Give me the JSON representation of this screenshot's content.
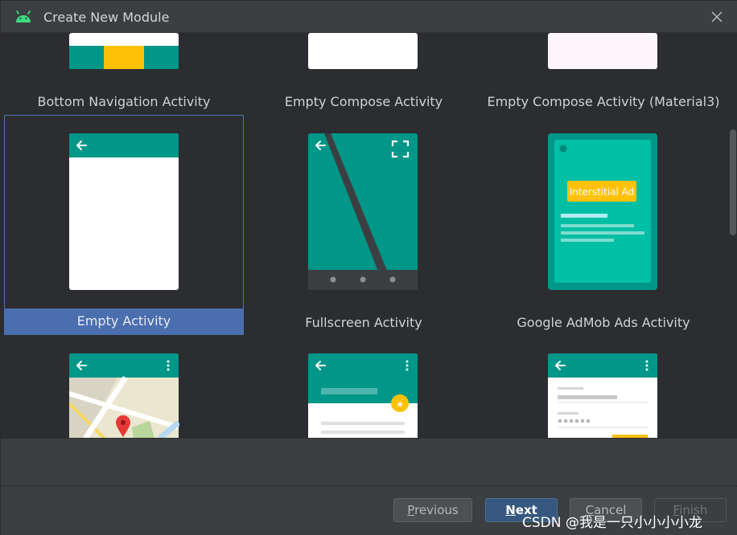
{
  "window": {
    "title": "Create New Module",
    "app_icon": "android-icon",
    "close_icon": "close-icon"
  },
  "templates": [
    {
      "label": "Bottom Navigation Activity",
      "icon": "bottom-navigation-preview",
      "selected": false
    },
    {
      "label": "Empty Compose Activity",
      "icon": "empty-compose-preview",
      "selected": false
    },
    {
      "label": "Empty Compose Activity (Material3)",
      "icon": "empty-compose-material3-preview",
      "selected": false
    },
    {
      "label": "Empty Activity",
      "icon": "empty-activity-preview",
      "selected": true
    },
    {
      "label": "Fullscreen Activity",
      "icon": "fullscreen-activity-preview",
      "selected": false
    },
    {
      "label": "Google AdMob Ads Activity",
      "icon": "admob-activity-preview",
      "selected": false,
      "ad_label": "Interstitial Ad"
    },
    {
      "label": "",
      "icon": "maps-activity-preview",
      "selected": false
    },
    {
      "label": "",
      "icon": "scrolling-activity-preview",
      "selected": false
    },
    {
      "label": "",
      "icon": "login-activity-preview",
      "selected": false
    }
  ],
  "footer": {
    "previous": {
      "mnemonic": "P",
      "rest": "revious"
    },
    "next": {
      "mnemonic": "N",
      "rest": "ext"
    },
    "cancel": {
      "mnemonic": "C",
      "rest": "ancel"
    },
    "finish": {
      "mnemonic": "F",
      "rest": "inish"
    }
  },
  "watermark": "CSDN @我是一只小小小小龙",
  "colors": {
    "teal": "#009688",
    "teal_light": "#00bfa5",
    "amber": "#ffc107",
    "selection": "#4b6eaf",
    "primary_button": "#365880"
  }
}
